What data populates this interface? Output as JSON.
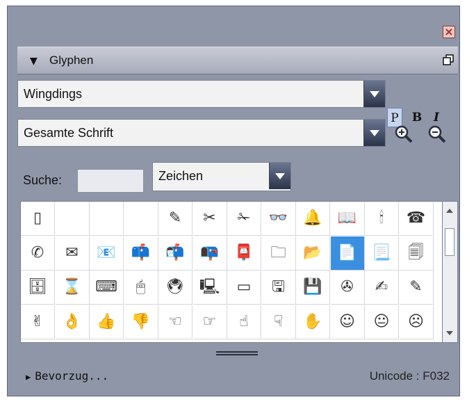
{
  "panel": {
    "title": "Glyphen",
    "font_family_value": "Wingdings",
    "style_options": [
      "P",
      "B",
      "I"
    ],
    "active_style": "P",
    "subset_value": "Gesamte Schrift",
    "search_label": "Suche:",
    "search_value": "",
    "search_mode_value": "Zeichen",
    "favorites_label": "Bevorzug...",
    "unicode_status": "Unicode : F032"
  },
  "icons": {
    "close": "close-icon",
    "float": "float-panel-icon",
    "zoom_in": "zoom-in-icon",
    "zoom_out": "zoom-out-icon"
  },
  "glyph_grid": {
    "rows": [
      [
        "▯",
        "",
        "",
        "",
        "✎",
        "✂",
        "✁",
        "👓",
        "🔔",
        "📖",
        "🕯",
        "☎"
      ],
      [
        "✆",
        "✉",
        "📧",
        "📫",
        "📬",
        "📭",
        "📮",
        "🗀",
        "📂",
        "📄",
        "📃",
        "🗐"
      ],
      [
        "🗄",
        "⌛",
        "⌨",
        "🖱",
        "🖲",
        "🖳",
        "▭",
        "🖫",
        "💾",
        "✇",
        "✍",
        "✎"
      ],
      [
        "✌",
        "👌",
        "👍",
        "👎",
        "☜",
        "☞",
        "☝",
        "☟",
        "✋",
        "☺",
        "😐",
        "☹"
      ]
    ],
    "selected": {
      "row": 1,
      "col": 9
    }
  },
  "colors": {
    "panel_bg": "#8f96a8",
    "selection": "#3b8fe0"
  }
}
